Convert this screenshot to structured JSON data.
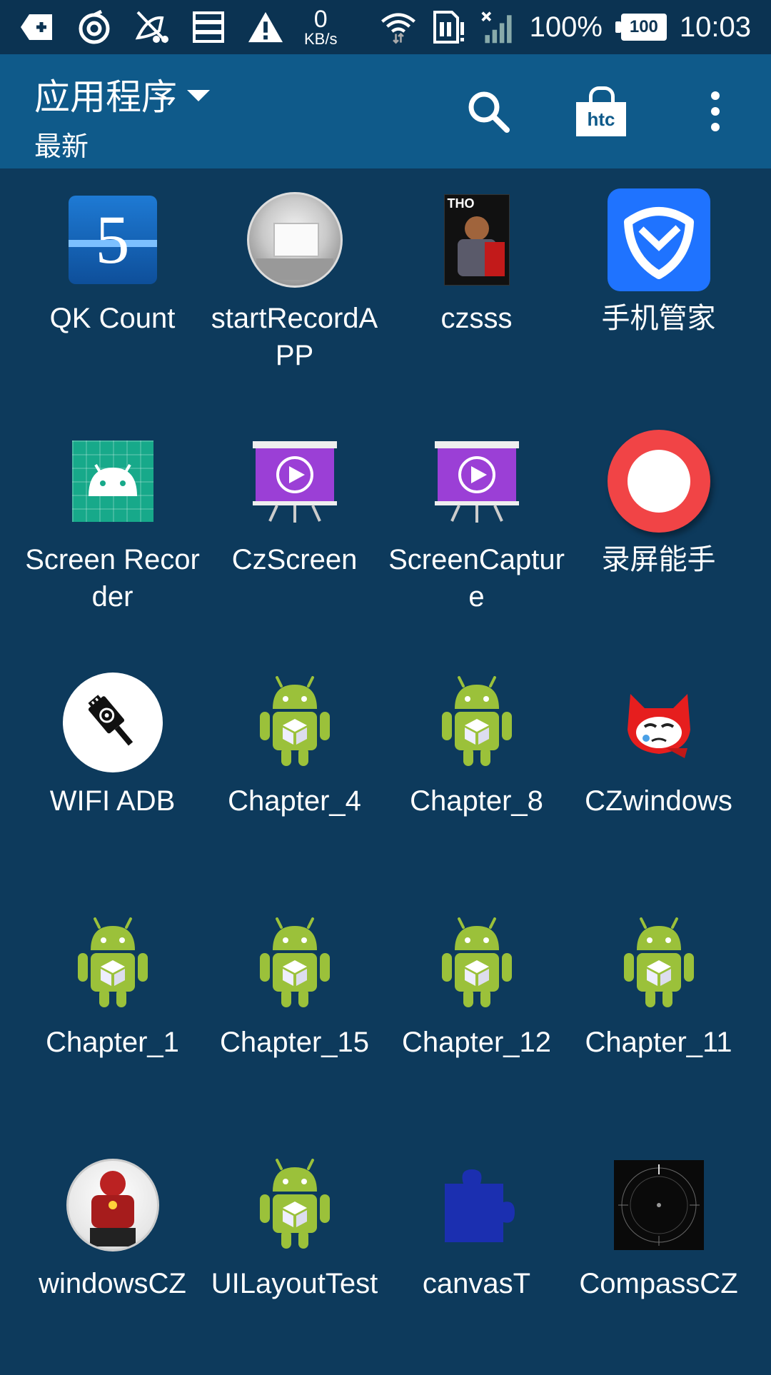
{
  "status_bar": {
    "net_speed_value": "0",
    "net_speed_unit": "KB/s",
    "battery_percent": "100%",
    "battery_level": "100",
    "time": "10:03",
    "icons": [
      "notification-plus-icon",
      "swirl-icon",
      "muted-icon",
      "storage-icon",
      "warning-icon",
      "wifi-icon",
      "sim-icon",
      "signal-icon",
      "battery-icon"
    ]
  },
  "app_bar": {
    "title": "应用程序",
    "subtitle": "最新",
    "search_icon": "search-icon",
    "store_label": "htc",
    "more_icon": "more-vert-icon"
  },
  "apps": [
    {
      "label": "QK Count",
      "icon": "qk-count-icon"
    },
    {
      "label": "startRecordAPP",
      "icon": "start-record-icon"
    },
    {
      "label": "czsss",
      "icon": "czsss-icon"
    },
    {
      "label": "手机管家",
      "icon": "phone-manager-icon"
    },
    {
      "label": "Screen Recorder",
      "icon": "screen-recorder-icon"
    },
    {
      "label": "CzScreen",
      "icon": "czscreen-icon"
    },
    {
      "label": "ScreenCapture",
      "icon": "screen-capture-icon"
    },
    {
      "label": "录屏能手",
      "icon": "record-screen-icon"
    },
    {
      "label": "WIFI ADB",
      "icon": "wifi-adb-icon"
    },
    {
      "label": "Chapter_4",
      "icon": "android-icon"
    },
    {
      "label": "Chapter_8",
      "icon": "android-icon"
    },
    {
      "label": "CZwindows",
      "icon": "czwindows-icon"
    },
    {
      "label": "Chapter_1",
      "icon": "android-icon"
    },
    {
      "label": "Chapter_15",
      "icon": "android-icon"
    },
    {
      "label": "Chapter_12",
      "icon": "android-icon"
    },
    {
      "label": "Chapter_11",
      "icon": "android-icon"
    },
    {
      "label": "windowsCZ",
      "icon": "windowscz-icon"
    },
    {
      "label": "UILayoutTest",
      "icon": "android-icon"
    },
    {
      "label": "canvasT",
      "icon": "puzzle-icon"
    },
    {
      "label": "CompassCZ",
      "icon": "compass-icon"
    }
  ],
  "colors": {
    "background": "#0d3a5c",
    "app_bar": "#0f5a8a",
    "status_bar": "#0b3352",
    "android_green": "#9bc13a"
  }
}
